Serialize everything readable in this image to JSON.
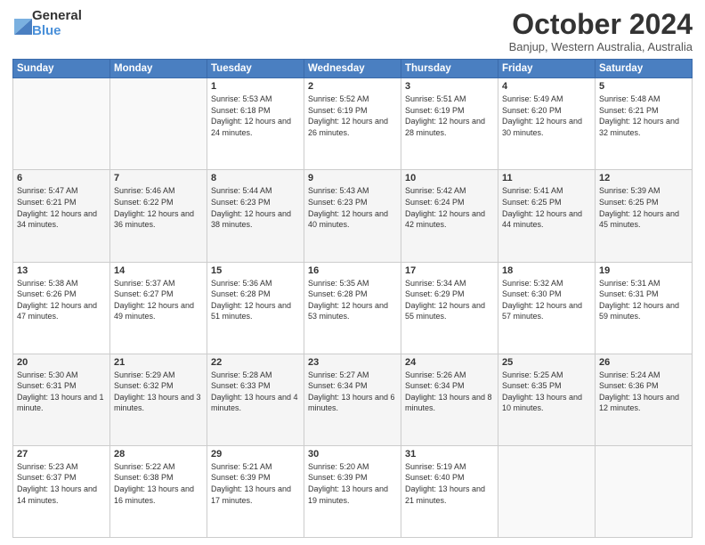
{
  "logo": {
    "general": "General",
    "blue": "Blue"
  },
  "title": "October 2024",
  "subtitle": "Banjup, Western Australia, Australia",
  "weekdays": [
    "Sunday",
    "Monday",
    "Tuesday",
    "Wednesday",
    "Thursday",
    "Friday",
    "Saturday"
  ],
  "weeks": [
    [
      {
        "day": "",
        "info": ""
      },
      {
        "day": "",
        "info": ""
      },
      {
        "day": "1",
        "info": "Sunrise: 5:53 AM\nSunset: 6:18 PM\nDaylight: 12 hours and 24 minutes."
      },
      {
        "day": "2",
        "info": "Sunrise: 5:52 AM\nSunset: 6:19 PM\nDaylight: 12 hours and 26 minutes."
      },
      {
        "day": "3",
        "info": "Sunrise: 5:51 AM\nSunset: 6:19 PM\nDaylight: 12 hours and 28 minutes."
      },
      {
        "day": "4",
        "info": "Sunrise: 5:49 AM\nSunset: 6:20 PM\nDaylight: 12 hours and 30 minutes."
      },
      {
        "day": "5",
        "info": "Sunrise: 5:48 AM\nSunset: 6:21 PM\nDaylight: 12 hours and 32 minutes."
      }
    ],
    [
      {
        "day": "6",
        "info": "Sunrise: 5:47 AM\nSunset: 6:21 PM\nDaylight: 12 hours and 34 minutes."
      },
      {
        "day": "7",
        "info": "Sunrise: 5:46 AM\nSunset: 6:22 PM\nDaylight: 12 hours and 36 minutes."
      },
      {
        "day": "8",
        "info": "Sunrise: 5:44 AM\nSunset: 6:23 PM\nDaylight: 12 hours and 38 minutes."
      },
      {
        "day": "9",
        "info": "Sunrise: 5:43 AM\nSunset: 6:23 PM\nDaylight: 12 hours and 40 minutes."
      },
      {
        "day": "10",
        "info": "Sunrise: 5:42 AM\nSunset: 6:24 PM\nDaylight: 12 hours and 42 minutes."
      },
      {
        "day": "11",
        "info": "Sunrise: 5:41 AM\nSunset: 6:25 PM\nDaylight: 12 hours and 44 minutes."
      },
      {
        "day": "12",
        "info": "Sunrise: 5:39 AM\nSunset: 6:25 PM\nDaylight: 12 hours and 45 minutes."
      }
    ],
    [
      {
        "day": "13",
        "info": "Sunrise: 5:38 AM\nSunset: 6:26 PM\nDaylight: 12 hours and 47 minutes."
      },
      {
        "day": "14",
        "info": "Sunrise: 5:37 AM\nSunset: 6:27 PM\nDaylight: 12 hours and 49 minutes."
      },
      {
        "day": "15",
        "info": "Sunrise: 5:36 AM\nSunset: 6:28 PM\nDaylight: 12 hours and 51 minutes."
      },
      {
        "day": "16",
        "info": "Sunrise: 5:35 AM\nSunset: 6:28 PM\nDaylight: 12 hours and 53 minutes."
      },
      {
        "day": "17",
        "info": "Sunrise: 5:34 AM\nSunset: 6:29 PM\nDaylight: 12 hours and 55 minutes."
      },
      {
        "day": "18",
        "info": "Sunrise: 5:32 AM\nSunset: 6:30 PM\nDaylight: 12 hours and 57 minutes."
      },
      {
        "day": "19",
        "info": "Sunrise: 5:31 AM\nSunset: 6:31 PM\nDaylight: 12 hours and 59 minutes."
      }
    ],
    [
      {
        "day": "20",
        "info": "Sunrise: 5:30 AM\nSunset: 6:31 PM\nDaylight: 13 hours and 1 minute."
      },
      {
        "day": "21",
        "info": "Sunrise: 5:29 AM\nSunset: 6:32 PM\nDaylight: 13 hours and 3 minutes."
      },
      {
        "day": "22",
        "info": "Sunrise: 5:28 AM\nSunset: 6:33 PM\nDaylight: 13 hours and 4 minutes."
      },
      {
        "day": "23",
        "info": "Sunrise: 5:27 AM\nSunset: 6:34 PM\nDaylight: 13 hours and 6 minutes."
      },
      {
        "day": "24",
        "info": "Sunrise: 5:26 AM\nSunset: 6:34 PM\nDaylight: 13 hours and 8 minutes."
      },
      {
        "day": "25",
        "info": "Sunrise: 5:25 AM\nSunset: 6:35 PM\nDaylight: 13 hours and 10 minutes."
      },
      {
        "day": "26",
        "info": "Sunrise: 5:24 AM\nSunset: 6:36 PM\nDaylight: 13 hours and 12 minutes."
      }
    ],
    [
      {
        "day": "27",
        "info": "Sunrise: 5:23 AM\nSunset: 6:37 PM\nDaylight: 13 hours and 14 minutes."
      },
      {
        "day": "28",
        "info": "Sunrise: 5:22 AM\nSunset: 6:38 PM\nDaylight: 13 hours and 16 minutes."
      },
      {
        "day": "29",
        "info": "Sunrise: 5:21 AM\nSunset: 6:39 PM\nDaylight: 13 hours and 17 minutes."
      },
      {
        "day": "30",
        "info": "Sunrise: 5:20 AM\nSunset: 6:39 PM\nDaylight: 13 hours and 19 minutes."
      },
      {
        "day": "31",
        "info": "Sunrise: 5:19 AM\nSunset: 6:40 PM\nDaylight: 13 hours and 21 minutes."
      },
      {
        "day": "",
        "info": ""
      },
      {
        "day": "",
        "info": ""
      }
    ]
  ]
}
